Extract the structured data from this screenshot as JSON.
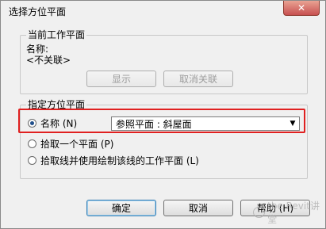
{
  "window": {
    "title": "选择方位平面",
    "close_glyph": "✕"
  },
  "current_plane": {
    "legend": "当前工作平面",
    "name_label": "名称:",
    "name_value": "<不关联>",
    "show_button": "显示",
    "disassociate_button": "取消关联"
  },
  "specify_plane": {
    "legend": "指定方位平面",
    "option_name": "名称 (N)",
    "option_name_checked": true,
    "dropdown_value": "参照平面 : 斜屋面",
    "option_pick_plane": "拾取一个平面 (P)",
    "option_pick_line": "拾取线并使用绘制该线的工作平面 (L)"
  },
  "footer": {
    "ok_button": "确定",
    "cancel_button": "取消",
    "help_button": "帮助 (H)"
  },
  "watermark": {
    "text": "tbe Revit讲堂"
  },
  "colors": {
    "highlight": "#e02020",
    "accent": "#1f4e8a"
  },
  "icons": {
    "close": "close-icon",
    "dropdown": "chevron-down-icon"
  }
}
